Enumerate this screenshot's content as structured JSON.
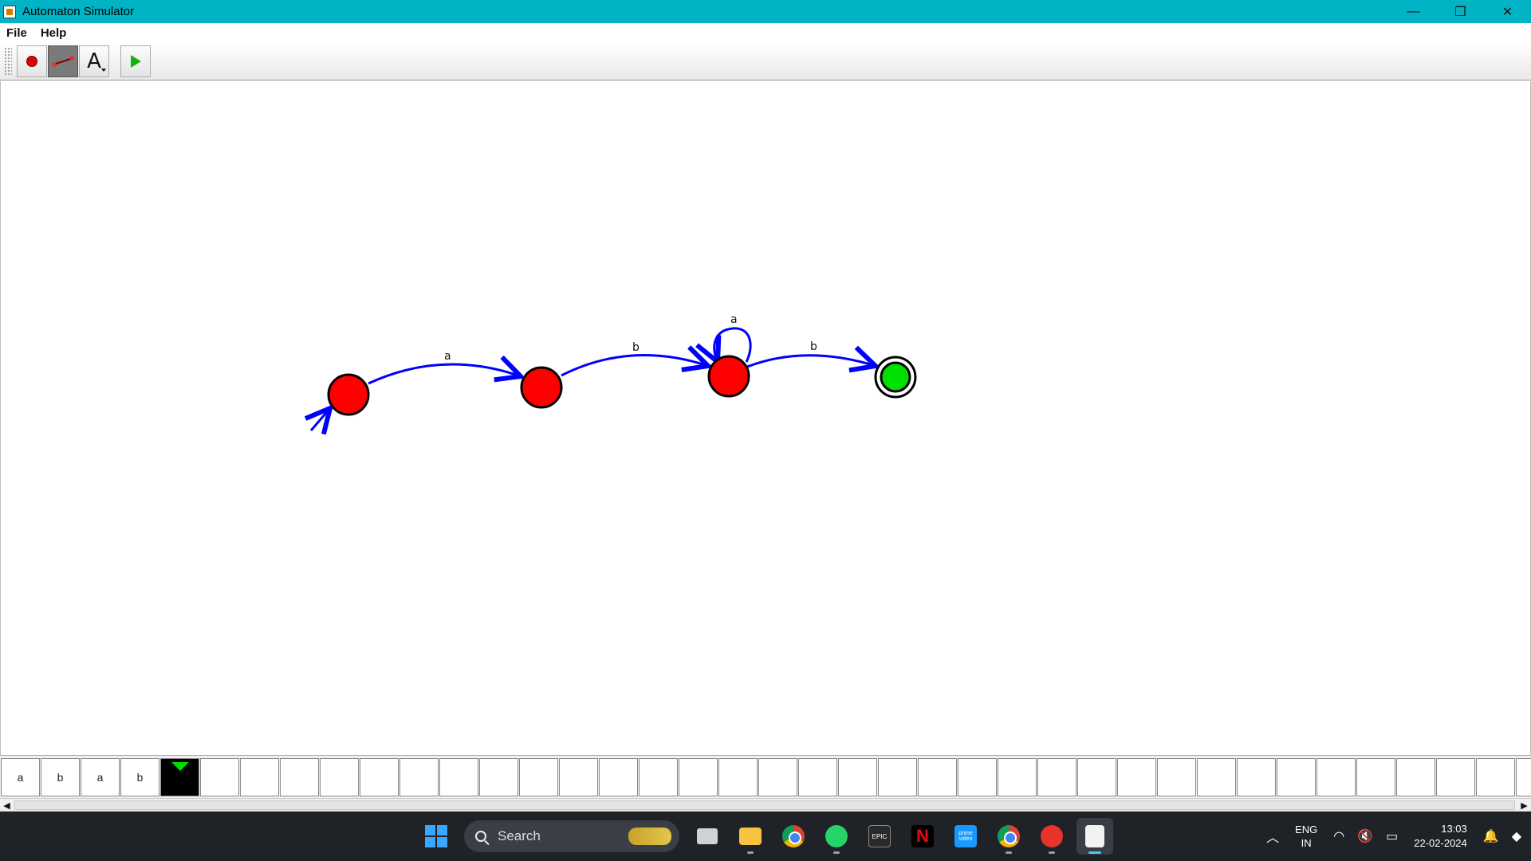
{
  "window": {
    "title": "Automaton Simulator",
    "controls": {
      "minimize": "—",
      "restore": "❐",
      "close": "✕"
    }
  },
  "menubar": {
    "items": [
      "File",
      "Help"
    ]
  },
  "toolbar": {
    "tools": [
      {
        "name": "add-state-tool",
        "icon": "red-dot-icon",
        "active": false
      },
      {
        "name": "add-transition-tool",
        "icon": "line-icon",
        "active": true
      },
      {
        "name": "add-text-tool",
        "icon": "letter-a-icon",
        "label": "A",
        "active": false
      },
      {
        "name": "run-tool",
        "icon": "play-icon",
        "active": false
      }
    ]
  },
  "automaton": {
    "states": [
      {
        "id": "q0",
        "initial": true,
        "accepting": false,
        "active": false,
        "color": "#ff0000"
      },
      {
        "id": "q1",
        "initial": false,
        "accepting": false,
        "active": false,
        "color": "#ff0000"
      },
      {
        "id": "q2",
        "initial": false,
        "accepting": false,
        "active": false,
        "color": "#ff0000"
      },
      {
        "id": "q3",
        "initial": false,
        "accepting": true,
        "active": true,
        "color": "#00e000"
      }
    ],
    "transitions": [
      {
        "from": "q0",
        "to": "q1",
        "label": "a"
      },
      {
        "from": "q1",
        "to": "q2",
        "label": "b"
      },
      {
        "from": "q2",
        "to": "q2",
        "label": "a"
      },
      {
        "from": "q2",
        "to": "q3",
        "label": "b"
      }
    ],
    "edge_color": "#0000ff"
  },
  "tape": {
    "symbols": [
      "a",
      "b",
      "a",
      "b"
    ],
    "head_index": 4,
    "total_cells": 39
  },
  "taskbar": {
    "search_placeholder": "Search",
    "apps": [
      "task-view",
      "file-explorer",
      "chrome",
      "whatsapp",
      "epic-games",
      "netflix",
      "prime-video",
      "chrome",
      "wps-office",
      "java"
    ],
    "language": {
      "line1": "ENG",
      "line2": "IN"
    },
    "time": "13:03",
    "date": "22-02-2024",
    "epic_label": "EPIC",
    "netflix_label": "N",
    "prime_label": "prime video"
  }
}
